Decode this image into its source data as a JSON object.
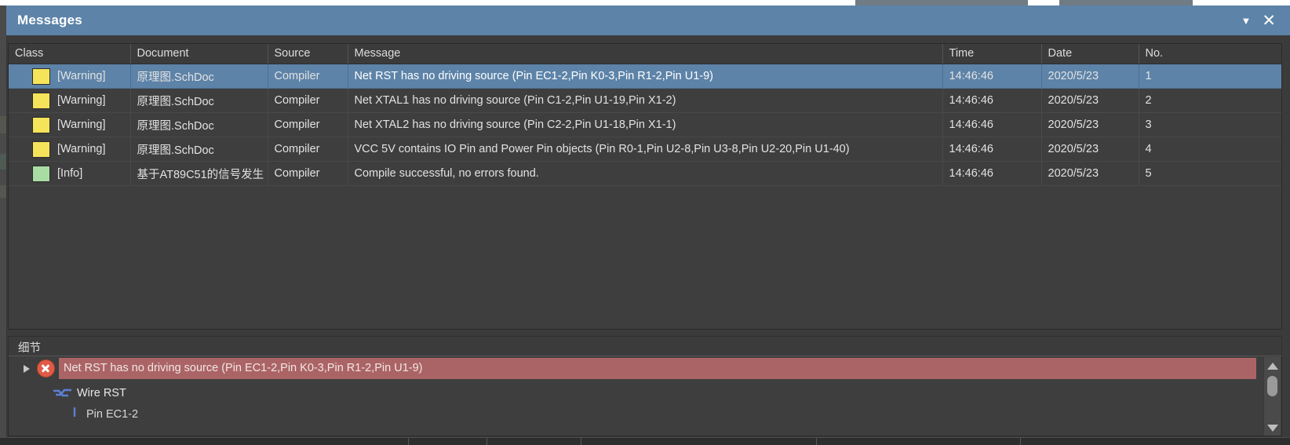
{
  "window": {
    "title": "Messages",
    "collapse_icon": "chevron-down-icon",
    "collapse_glyph": "▼",
    "close_icon": "close-icon",
    "close_glyph": "✕",
    "titlebar_color": "#5d83a8"
  },
  "grid": {
    "columns": [
      {
        "key": "class",
        "label": "Class"
      },
      {
        "key": "document",
        "label": "Document"
      },
      {
        "key": "source",
        "label": "Source"
      },
      {
        "key": "message",
        "label": "Message"
      },
      {
        "key": "time",
        "label": "Time"
      },
      {
        "key": "date",
        "label": "Date"
      },
      {
        "key": "no",
        "label": "No."
      }
    ],
    "severity_colors": {
      "warning": "#f5e35a",
      "info": "#a9dca2"
    },
    "rows": [
      {
        "severity": "warning",
        "class": "[Warning]",
        "document": "原理图.SchDoc",
        "source": "Compiler",
        "message": "Net RST has no driving source (Pin EC1-2,Pin K0-3,Pin R1-2,Pin U1-9)",
        "time": "14:46:46",
        "date": "2020/5/23",
        "no": "1",
        "selected": true
      },
      {
        "severity": "warning",
        "class": "[Warning]",
        "document": "原理图.SchDoc",
        "source": "Compiler",
        "message": "Net XTAL1 has no driving source (Pin C1-2,Pin U1-19,Pin X1-2)",
        "time": "14:46:46",
        "date": "2020/5/23",
        "no": "2",
        "selected": false
      },
      {
        "severity": "warning",
        "class": "[Warning]",
        "document": "原理图.SchDoc",
        "source": "Compiler",
        "message": "Net XTAL2 has no driving source (Pin C2-2,Pin U1-18,Pin X1-1)",
        "time": "14:46:46",
        "date": "2020/5/23",
        "no": "3",
        "selected": false
      },
      {
        "severity": "warning",
        "class": "[Warning]",
        "document": "原理图.SchDoc",
        "source": "Compiler",
        "message": "VCC 5V contains IO Pin and Power Pin objects (Pin R0-1,Pin U2-8,Pin U3-8,Pin U2-20,Pin U1-40)",
        "time": "14:46:46",
        "date": "2020/5/23",
        "no": "4",
        "selected": false
      },
      {
        "severity": "info",
        "class": "[Info]",
        "document": "基于AT89C51的信号发生",
        "source": "Compiler",
        "message": "Compile successful, no errors found.",
        "time": "14:46:46",
        "date": "2020/5/23",
        "no": "5",
        "selected": false
      }
    ]
  },
  "details": {
    "header": "细节",
    "error_icon": "error-circle-icon",
    "error_text": "Net RST has no driving source (Pin EC1-2,Pin K0-3,Pin R1-2,Pin U1-9)",
    "error_row_color": "#ab6465",
    "children": [
      {
        "icon": "wire-icon",
        "label": "Wire RST"
      },
      {
        "icon": "pin-icon",
        "label": "Pin EC1-2"
      }
    ],
    "scrollbar": {
      "up_icon": "scroll-up-arrow-icon",
      "down_icon": "scroll-down-arrow-icon",
      "thumb_icon": "scroll-thumb"
    }
  }
}
